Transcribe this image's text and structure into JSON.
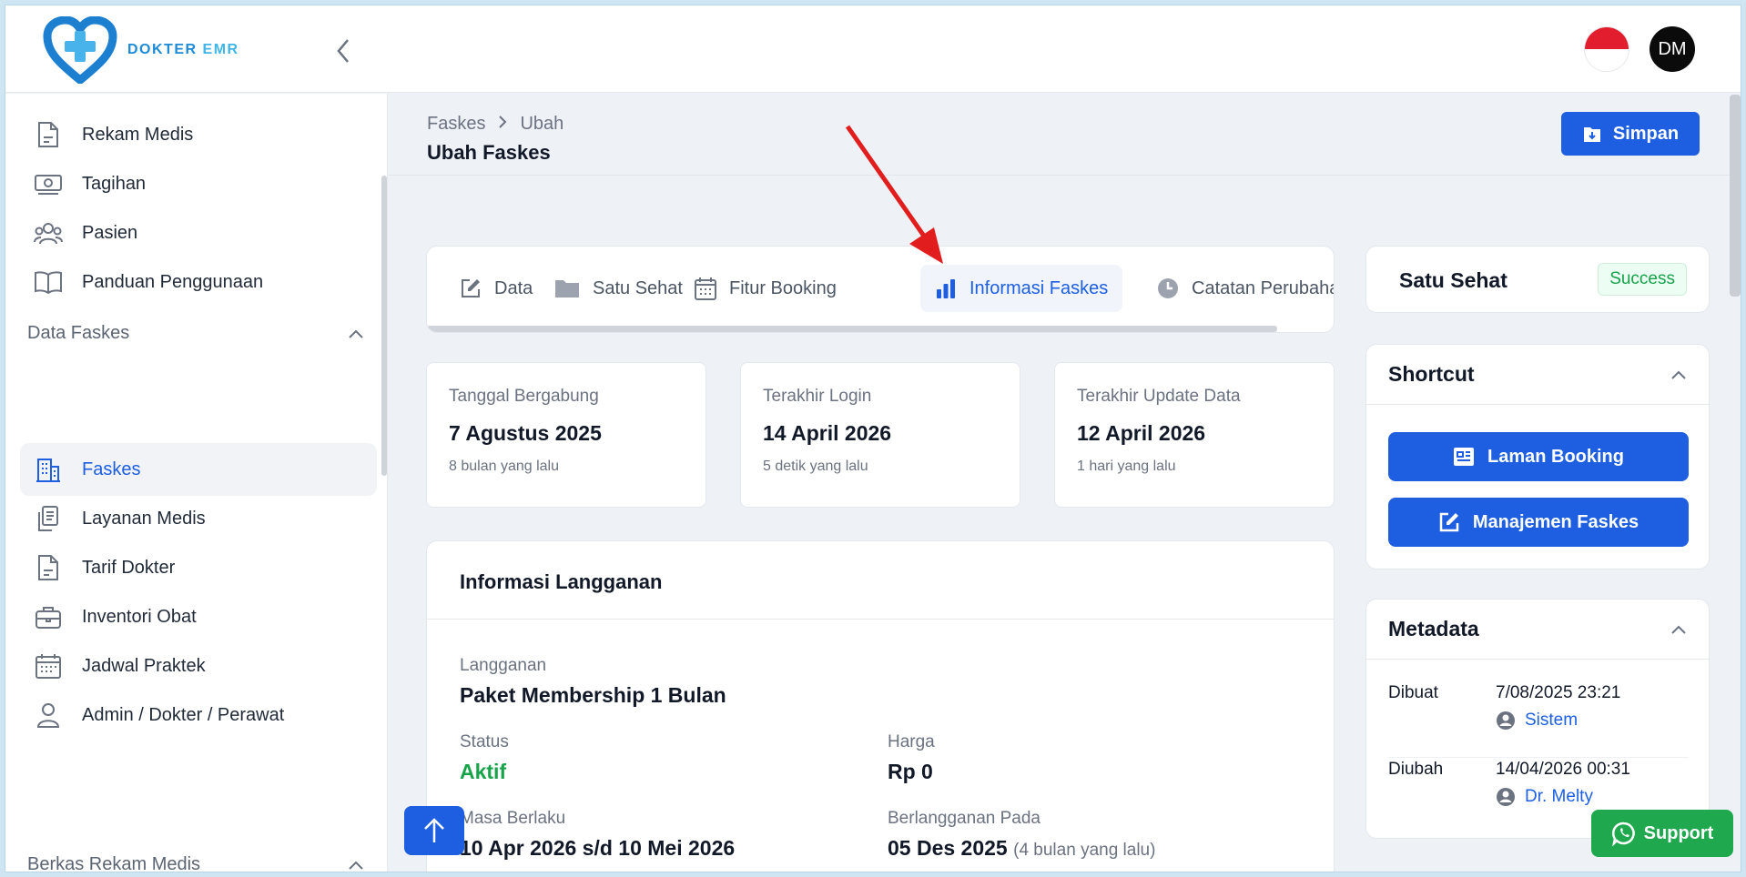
{
  "brand": {
    "name_prefix": "DOKTER",
    "name_suffix": "EMR"
  },
  "header": {
    "avatar_initials": "DM",
    "language": "id"
  },
  "sidebar": {
    "items_top": [
      {
        "label": "Rekam Medis",
        "icon": "document-icon"
      },
      {
        "label": "Tagihan",
        "icon": "money-icon"
      },
      {
        "label": "Pasien",
        "icon": "users-icon"
      },
      {
        "label": "Panduan Penggunaan",
        "icon": "book-icon"
      }
    ],
    "section_faskes": "Data Faskes",
    "items_faskes": [
      {
        "label": "Faskes",
        "icon": "building-icon",
        "active": true
      },
      {
        "label": "Layanan Medis",
        "icon": "clipboard-icon"
      },
      {
        "label": "Tarif Dokter",
        "icon": "document-icon"
      },
      {
        "label": "Inventori Obat",
        "icon": "briefcase-icon"
      },
      {
        "label": "Jadwal Praktek",
        "icon": "calendar-icon"
      },
      {
        "label": "Admin / Dokter / Perawat",
        "icon": "user-icon"
      }
    ],
    "section_berkas": "Berkas Rekam Medis"
  },
  "breadcrumb": {
    "parent": "Faskes",
    "current": "Ubah"
  },
  "page_title": "Ubah Faskes",
  "save_label": "Simpan",
  "tabs": [
    {
      "label": "Data",
      "icon": "edit-icon"
    },
    {
      "label": "Satu Sehat",
      "icon": "folder-icon"
    },
    {
      "label": "Fitur Booking",
      "icon": "calendar-icon"
    },
    {
      "label": "Informasi Faskes",
      "icon": "bar-chart-icon",
      "active": true
    },
    {
      "label": "Catatan Perubahan",
      "icon": "clock-icon"
    }
  ],
  "stats": [
    {
      "label": "Tanggal Bergabung",
      "value": "7 Agustus 2025",
      "sub": "8 bulan yang lalu"
    },
    {
      "label": "Terakhir Login",
      "value": "14 April 2026",
      "sub": "5 detik yang lalu"
    },
    {
      "label": "Terakhir Update Data",
      "value": "12 April 2026",
      "sub": "1 hari yang lalu"
    }
  ],
  "subscription": {
    "title": "Informasi Langganan",
    "plan_label": "Langganan",
    "plan_value": "Paket Membership 1 Bulan",
    "status_label": "Status",
    "status_value": "Aktif",
    "price_label": "Harga",
    "price_value": "Rp 0",
    "period_label": "Masa Berlaku",
    "period_value": "10 Apr 2026 s/d 10 Mei 2026",
    "subscribed_label": "Berlangganan Pada",
    "subscribed_value": "05 Des 2025",
    "subscribed_rel": "(4 bulan yang lalu)"
  },
  "satu_sehat": {
    "title": "Satu Sehat",
    "status": "Success"
  },
  "shortcut": {
    "title": "Shortcut",
    "booking_label": "Laman Booking",
    "manage_label": "Manajemen Faskes"
  },
  "metadata": {
    "title": "Metadata",
    "created_label": "Dibuat",
    "created_date": "7/08/2025 23:21",
    "created_by": "Sistem",
    "updated_label": "Diubah",
    "updated_date": "14/04/2026 00:31",
    "updated_by": "Dr. Melty"
  },
  "support_label": "Support",
  "colors": {
    "primary": "#1d5fe0",
    "success": "#16a34a",
    "whatsapp": "#1fa84d",
    "annotation_arrow": "#e11d1d"
  }
}
